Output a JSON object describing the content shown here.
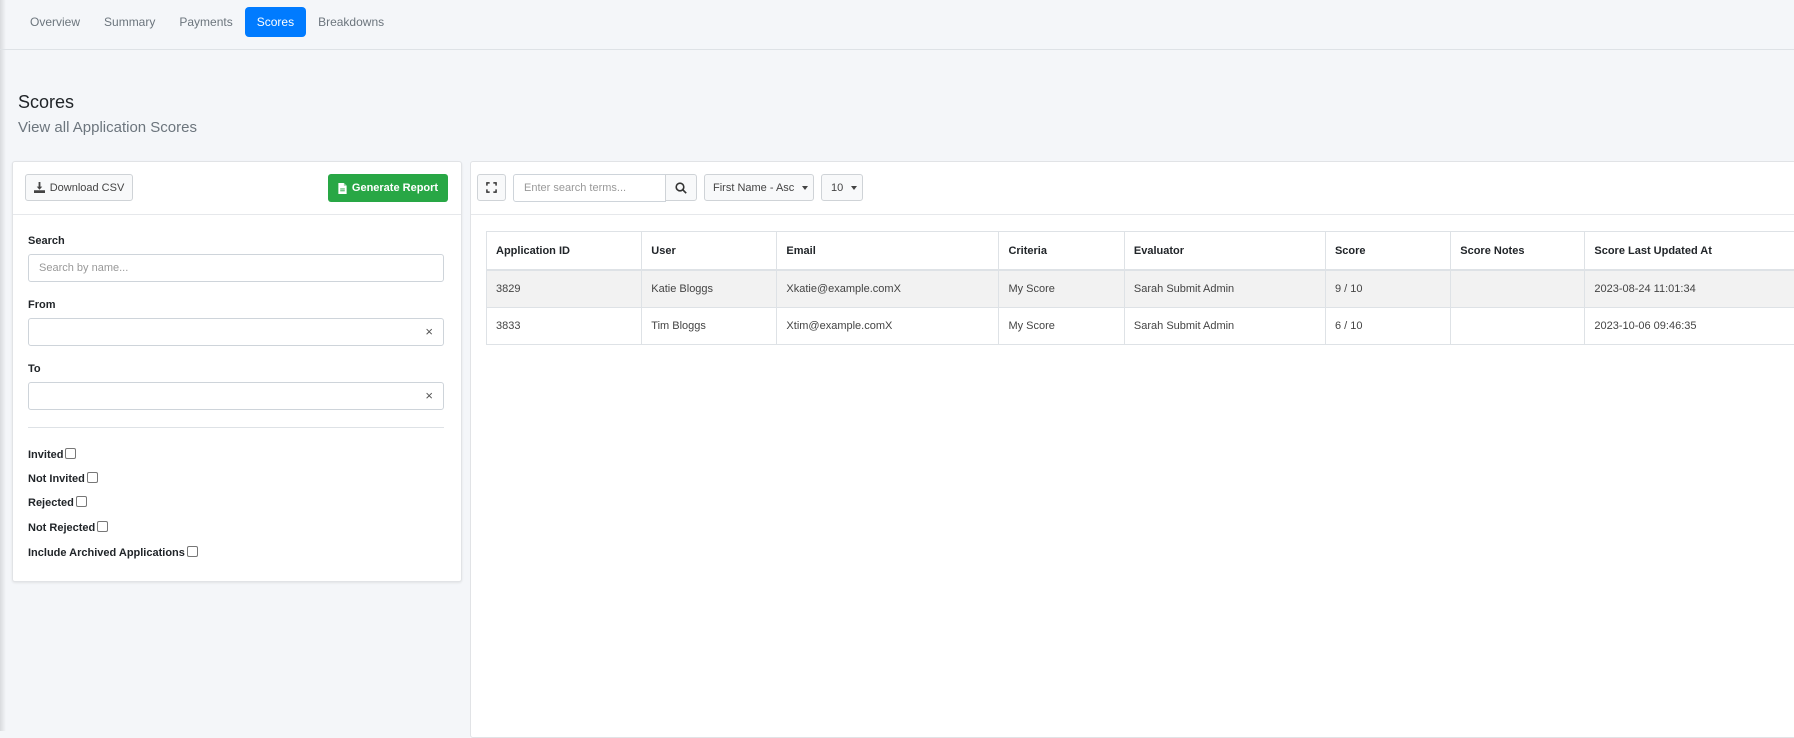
{
  "nav": {
    "tabs": [
      {
        "label": "Overview"
      },
      {
        "label": "Summary"
      },
      {
        "label": "Payments"
      },
      {
        "label": "Scores"
      },
      {
        "label": "Breakdowns"
      }
    ],
    "active": "Scores"
  },
  "header": {
    "title": "Scores",
    "subtitle": "View all Application Scores"
  },
  "filters": {
    "download_csv_label": "Download CSV",
    "generate_report_label": "Generate Report",
    "search_label": "Search",
    "search_placeholder": "Search by name...",
    "from_label": "From",
    "from_value": "",
    "to_label": "To",
    "to_value": "",
    "clear_glyph": "×",
    "checkboxes": [
      {
        "label": "Invited",
        "checked": false
      },
      {
        "label": "Not Invited",
        "checked": false
      },
      {
        "label": "Rejected",
        "checked": false
      },
      {
        "label": "Not Rejected",
        "checked": false
      },
      {
        "label": "Include Archived Applications",
        "checked": false
      }
    ]
  },
  "toolbar": {
    "search_placeholder": "Enter search terms...",
    "sort_value": "First Name - Asc",
    "page_size_value": "10"
  },
  "table": {
    "columns": [
      "Application ID",
      "User",
      "Email",
      "Criteria",
      "Evaluator",
      "Score",
      "Score Notes",
      "Score Last Updated At"
    ],
    "rows": [
      [
        "3829",
        "Katie Bloggs",
        "Xkatie@example.comX",
        "My Score",
        "Sarah Submit Admin",
        "9 / 10",
        "",
        "2023-08-24 11:01:34"
      ],
      [
        "3833",
        "Tim Bloggs",
        "Xtim@example.comX",
        "My Score",
        "Sarah Submit Admin",
        "6 / 10",
        "",
        "2023-10-06 09:46:35"
      ]
    ]
  },
  "colors": {
    "primary": "#007bff",
    "success": "#28a745",
    "background": "#f4f6f9"
  }
}
